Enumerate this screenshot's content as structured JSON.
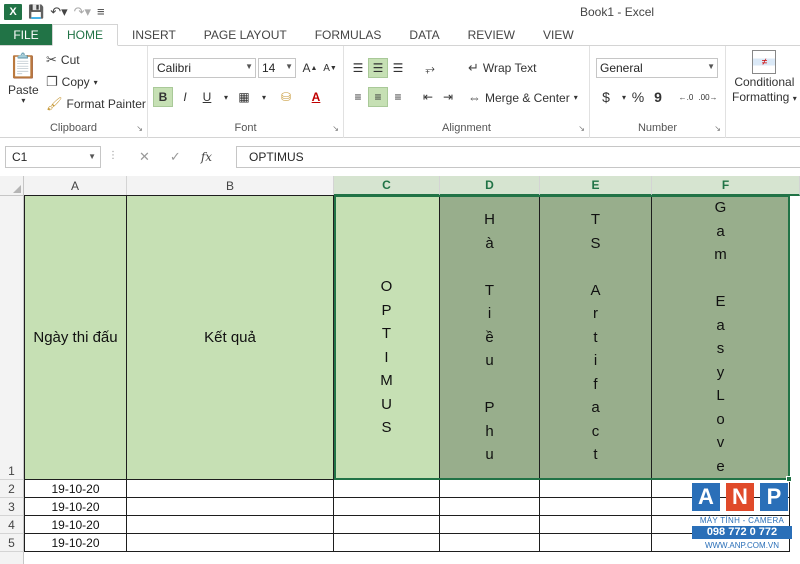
{
  "window": {
    "title": "Book1 - Excel"
  },
  "quick_access": {
    "app_icon": "X",
    "save_icon": "save-icon",
    "undo_icon": "undo-icon",
    "redo_icon": "redo-icon"
  },
  "tabs": [
    {
      "label": "FILE"
    },
    {
      "label": "HOME"
    },
    {
      "label": "INSERT"
    },
    {
      "label": "PAGE LAYOUT"
    },
    {
      "label": "FORMULAS"
    },
    {
      "label": "DATA"
    },
    {
      "label": "REVIEW"
    },
    {
      "label": "VIEW"
    }
  ],
  "ribbon": {
    "clipboard": {
      "label": "Clipboard",
      "paste": "Paste",
      "cut": "Cut",
      "copy": "Copy",
      "format_painter": "Format Painter"
    },
    "font": {
      "label": "Font",
      "name": "Calibri",
      "size": "14",
      "bold": "B",
      "italic": "I",
      "underline": "U"
    },
    "alignment": {
      "label": "Alignment",
      "wrap_text": "Wrap Text",
      "merge_center": "Merge & Center"
    },
    "number": {
      "label": "Number",
      "format": "General",
      "currency": "$",
      "percent": "%",
      "comma": "9"
    },
    "styles": {
      "conditional": "Conditional",
      "formatting": "Formatting"
    }
  },
  "formula_bar": {
    "name_box": "C1",
    "fx": "fx",
    "content": "OPTIMUS"
  },
  "columns": [
    "A",
    "B",
    "C",
    "D",
    "E",
    "F"
  ],
  "rows": [
    "1",
    "2",
    "3",
    "4",
    "5"
  ],
  "sheet": {
    "A1": "Ngày thi đấu",
    "B1": "Kết quả",
    "C1": [
      "O",
      "P",
      "T",
      "I",
      "M",
      "U",
      "S"
    ],
    "D1": [
      "H",
      "à",
      "",
      "T",
      "i",
      "ề",
      "u",
      "",
      "P",
      "h",
      "u"
    ],
    "E1": [
      "T",
      "S",
      "",
      "A",
      "r",
      "t",
      "i",
      "f",
      "a",
      "c",
      "t"
    ],
    "F1": [
      "G",
      "a",
      "m",
      "",
      "E",
      "a",
      "s",
      "y",
      "L",
      "o",
      "v",
      "e"
    ],
    "A2": "19-10-20",
    "A3": "19-10-20",
    "A4": "19-10-20",
    "A5": "19-10-20"
  },
  "colors": {
    "accent": "#217346",
    "light_green_fill": "#c6e0b4",
    "dark_green_fill": "#98ae8c"
  },
  "watermark": {
    "a": "A",
    "n": "N",
    "p": "P",
    "line1": "MÁY TÍNH - CAMERA",
    "phone": "098 772 0 772",
    "site": "WWW.ANP.COM.VN"
  }
}
